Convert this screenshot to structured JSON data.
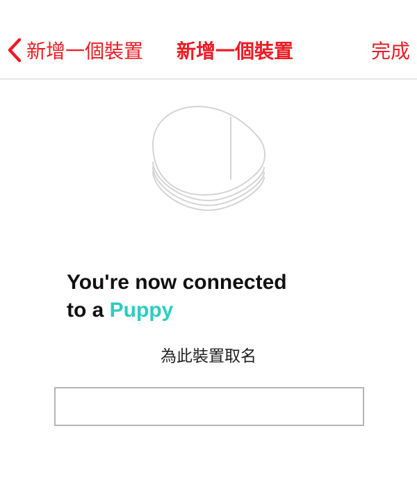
{
  "nav": {
    "back_label": "新增一個裝置",
    "title": "新增一個裝置",
    "done_label": "完成"
  },
  "main": {
    "headline_prefix": "You're now connected",
    "headline_line2_prefix": "to a ",
    "brand_name": "Puppy",
    "name_prompt": "為此裝置取名",
    "name_input": {
      "value": "",
      "placeholder": ""
    }
  },
  "colors": {
    "accent": "#ee1b24",
    "brand": "#2bcdc0",
    "outline": "#d4d4d4"
  },
  "icons": {
    "back": "chevron-left-icon",
    "device": "puppy-device-illustration"
  }
}
